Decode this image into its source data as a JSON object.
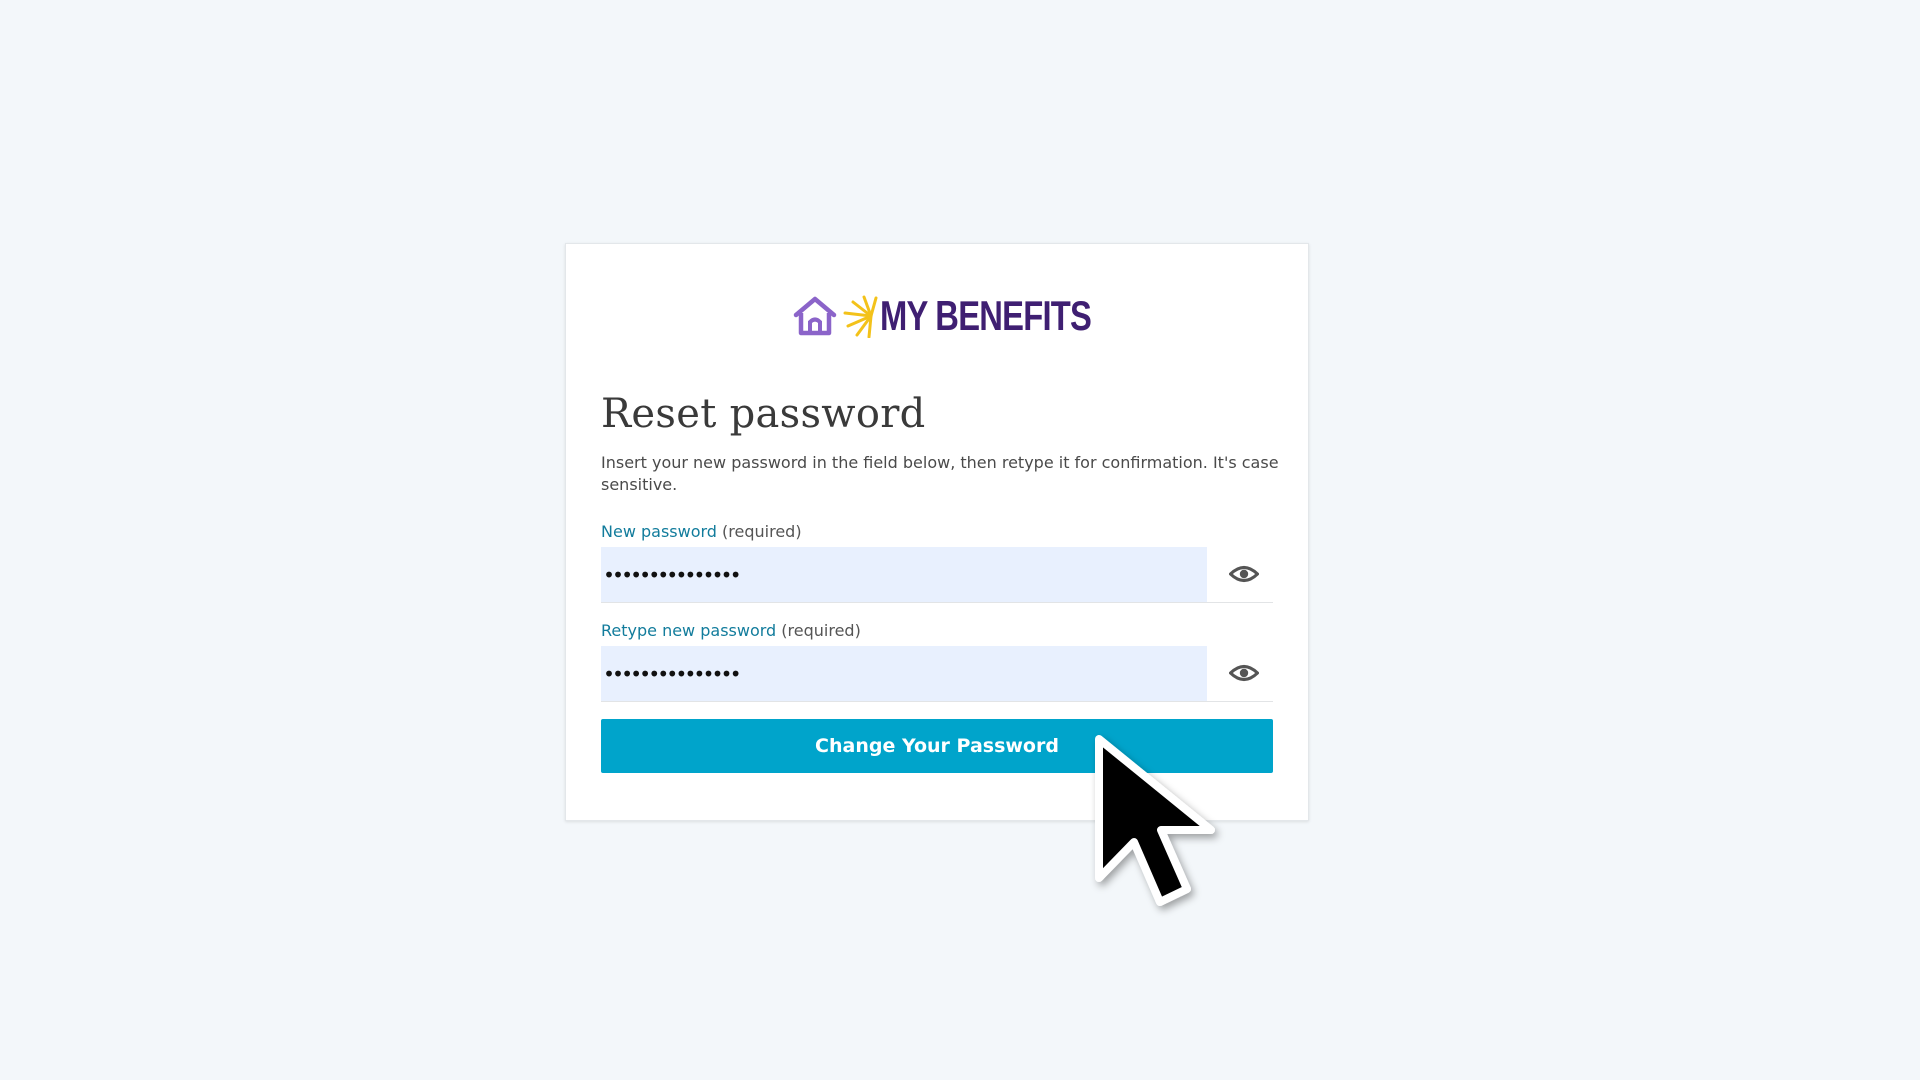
{
  "brand": {
    "name": "MY BENEFITS",
    "color": "#3f1f72",
    "house_color": "#8b64c9",
    "spark_color": "#f3c21a"
  },
  "page": {
    "title": "Reset password",
    "description": "Insert your new password in the field below, then retype it for confirmation. It's case sensitive."
  },
  "fields": [
    {
      "label": "New password",
      "required_text": "(required)",
      "value": "•••••••••••••••",
      "visibility_icon": "eye-icon"
    },
    {
      "label": "Retype new password",
      "required_text": "(required)",
      "value": "•••••••••••••••",
      "visibility_icon": "eye-icon"
    }
  ],
  "submit": {
    "label": "Change Your Password",
    "color": "#00a4cb"
  },
  "colors": {
    "background": "#f3f7fa",
    "link": "#127c9c",
    "input_fill": "#e8f0fe"
  }
}
